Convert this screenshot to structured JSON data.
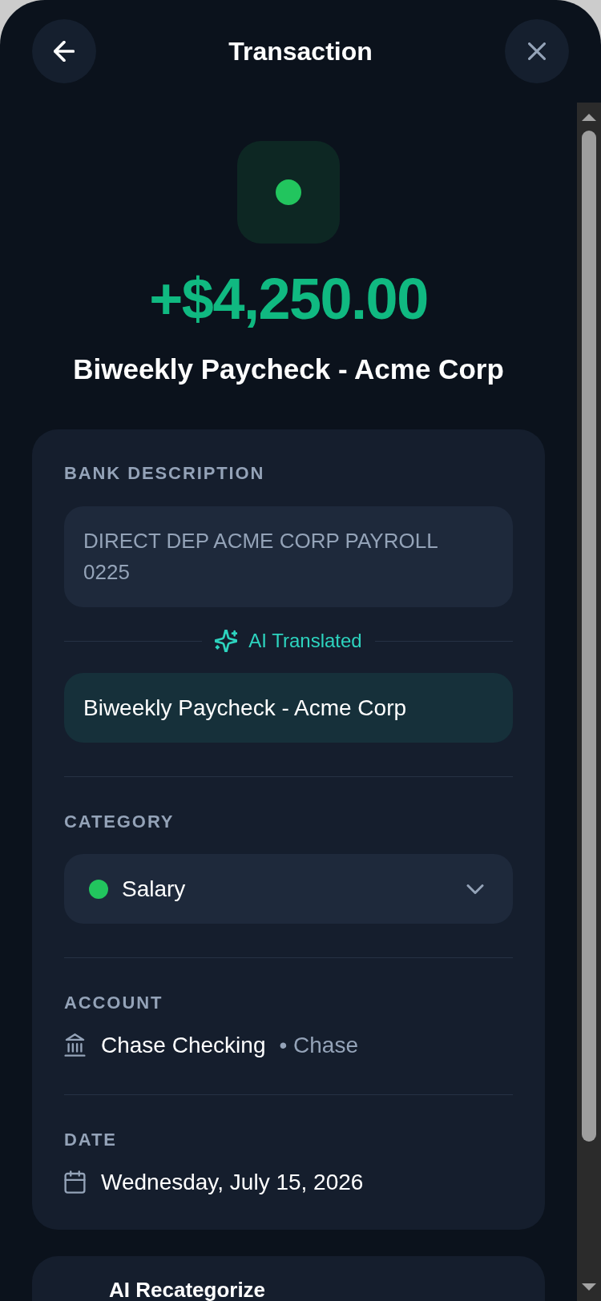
{
  "header": {
    "title": "Transaction"
  },
  "transaction": {
    "amount": "+$4,250.00",
    "title": "Biweekly Paycheck - Acme Corp"
  },
  "details": {
    "bank_description": {
      "label": "BANK DESCRIPTION",
      "value": "DIRECT DEP ACME CORP PAYROLL 0225"
    },
    "translation": {
      "badge": "AI Translated",
      "value": "Biweekly Paycheck - Acme Corp"
    },
    "category": {
      "label": "CATEGORY",
      "value": "Salary",
      "color": "#22c55e"
    },
    "account": {
      "label": "ACCOUNT",
      "name": "Chase Checking",
      "institution": "• Chase"
    },
    "date": {
      "label": "DATE",
      "value": "Wednesday, July 15, 2026"
    }
  },
  "recategorize": {
    "title": "AI Recategorize"
  }
}
